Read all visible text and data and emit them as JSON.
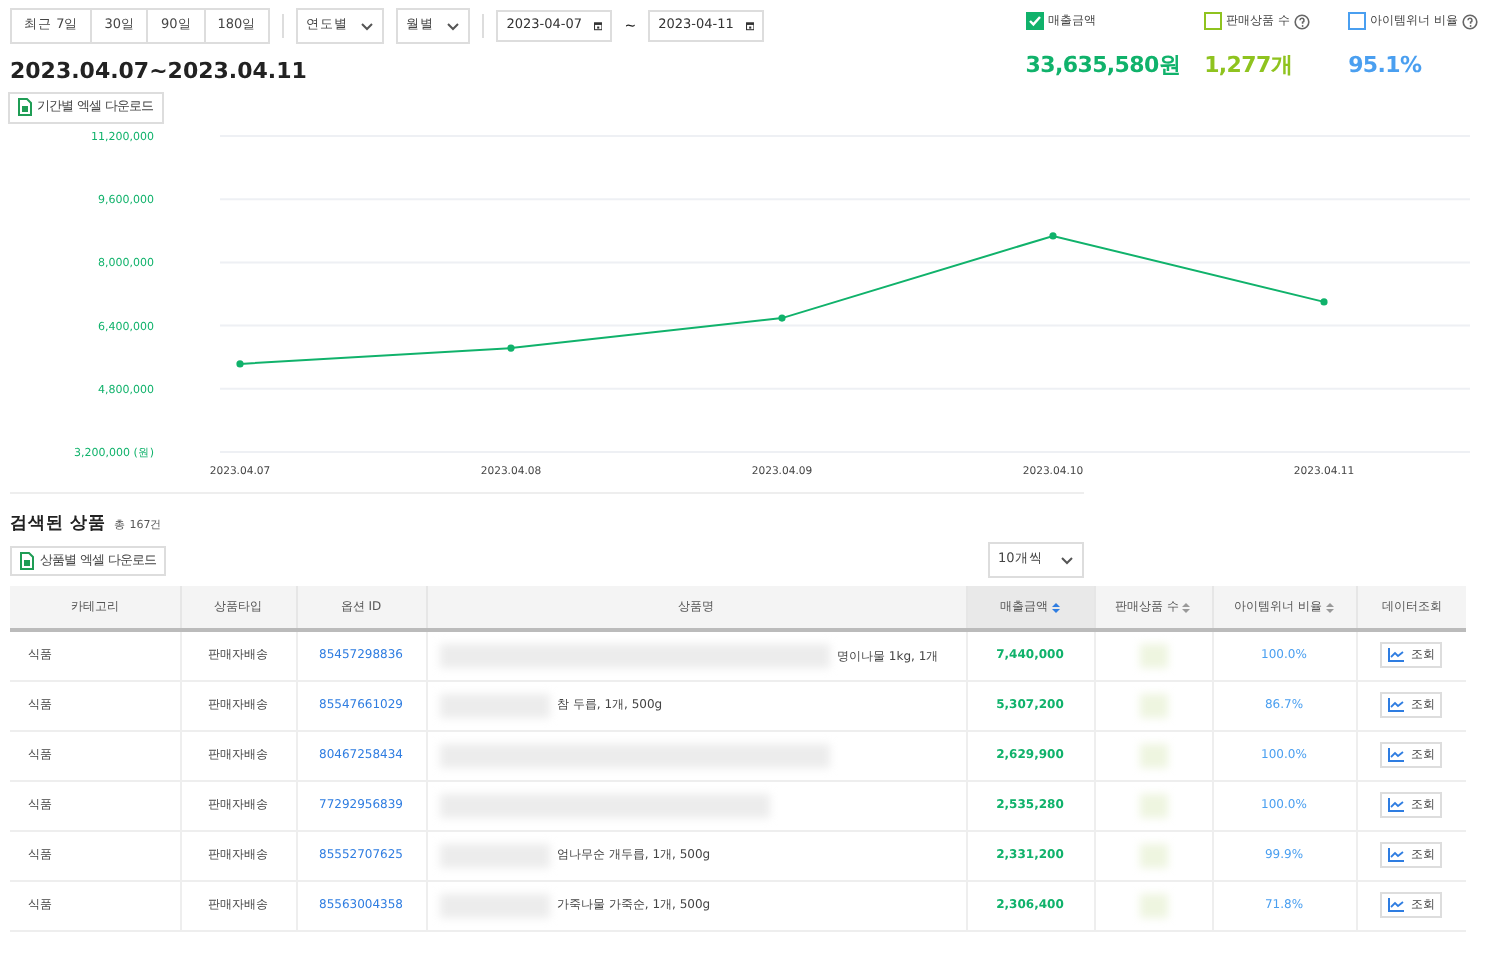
{
  "period_buttons": [
    {
      "label": "최근 7일",
      "selected": false
    },
    {
      "label": "30일",
      "selected": false
    },
    {
      "label": "90일",
      "selected": false
    },
    {
      "label": "180일",
      "selected": false
    }
  ],
  "unit_selects": [
    {
      "value": "연도별"
    },
    {
      "value": "월별"
    }
  ],
  "date_range": {
    "start": "2023-04-07",
    "separator": "~",
    "end": "2023-04-11"
  },
  "period_title": "2023.04.07~2023.04.11",
  "period_download": "기간별 엑셀 다운로드",
  "metrics": [
    {
      "label": "매출금액",
      "checked": true,
      "help": false,
      "value": "33,635,580원",
      "color": "#10b26b"
    },
    {
      "label": "판매상품 수",
      "checked": false,
      "help": true,
      "value": "1,277개",
      "color": "#8fc31f"
    },
    {
      "label": "아이템위너 비율",
      "checked": false,
      "help": true,
      "value": "95.1%",
      "color": "#4a9ff0"
    }
  ],
  "chart_data": {
    "type": "line",
    "categories": [
      "2023.04.07",
      "2023.04.08",
      "2023.04.09",
      "2023.04.10",
      "2023.04.11"
    ],
    "grid": true,
    "series": [
      {
        "color": "#10b26b",
        "marker": true,
        "values": [
          5430000,
          5830000,
          6590000,
          8670000,
          7000000
        ]
      }
    ],
    "ylim": [
      3200000,
      11200000
    ],
    "yticks": [
      {
        "value": 3200000,
        "label": "3,200,000 (원)"
      },
      {
        "value": 4800000,
        "label": "4,800,000"
      },
      {
        "value": 6400000,
        "label": "6,400,000"
      },
      {
        "value": 8000000,
        "label": "8,000,000"
      },
      {
        "value": 9600000,
        "label": "9,600,000"
      },
      {
        "value": 11200000,
        "label": "11,200,000"
      }
    ]
  },
  "products": {
    "title": "검색된 상품",
    "count": "총 167건",
    "download": "상품별 엑셀 다운로드",
    "page_size": "10개씩",
    "columns": [
      {
        "label": "카테고리",
        "sortable": false
      },
      {
        "label": "상품타입",
        "sortable": false
      },
      {
        "label": "옵션 ID",
        "sortable": false
      },
      {
        "label": "상품명",
        "sortable": false
      },
      {
        "label": "매출금액",
        "sortable": true,
        "sorted": true
      },
      {
        "label": "판매상품 수",
        "sortable": true,
        "sorted": false
      },
      {
        "label": "아이템위너 비율",
        "sortable": true,
        "sorted": false
      },
      {
        "label": "데이터조회",
        "sortable": false
      }
    ],
    "rows": [
      {
        "category": "식품",
        "type": "판매자배송",
        "option_id": "85457298836",
        "name": "명이나물 1kg, 1개",
        "sales": "7,440,000",
        "winner_ratio": "100.0%",
        "action": "조회"
      },
      {
        "category": "식품",
        "type": "판매자배송",
        "option_id": "85547661029",
        "name": "참 두릅, 1개, 500g",
        "sales": "5,307,200",
        "winner_ratio": "86.7%",
        "action": "조회"
      },
      {
        "category": "식품",
        "type": "판매자배송",
        "option_id": "80467258434",
        "sales": "2,629,900",
        "winner_ratio": "100.0%",
        "action": "조회"
      },
      {
        "category": "식품",
        "type": "판매자배송",
        "option_id": "77292956839",
        "sales": "2,535,280",
        "winner_ratio": "100.0%",
        "action": "조회"
      },
      {
        "category": "식품",
        "type": "판매자배송",
        "option_id": "85552707625",
        "name": "엄나무순 개두릅, 1개, 500g",
        "sales": "2,331,200",
        "winner_ratio": "99.9%",
        "action": "조회"
      },
      {
        "category": "식품",
        "type": "판매자배송",
        "option_id": "85563004358",
        "name": "가죽나물 가죽순, 1개, 500g",
        "sales": "2,306,400",
        "winner_ratio": "71.8%",
        "action": "조회"
      }
    ]
  }
}
